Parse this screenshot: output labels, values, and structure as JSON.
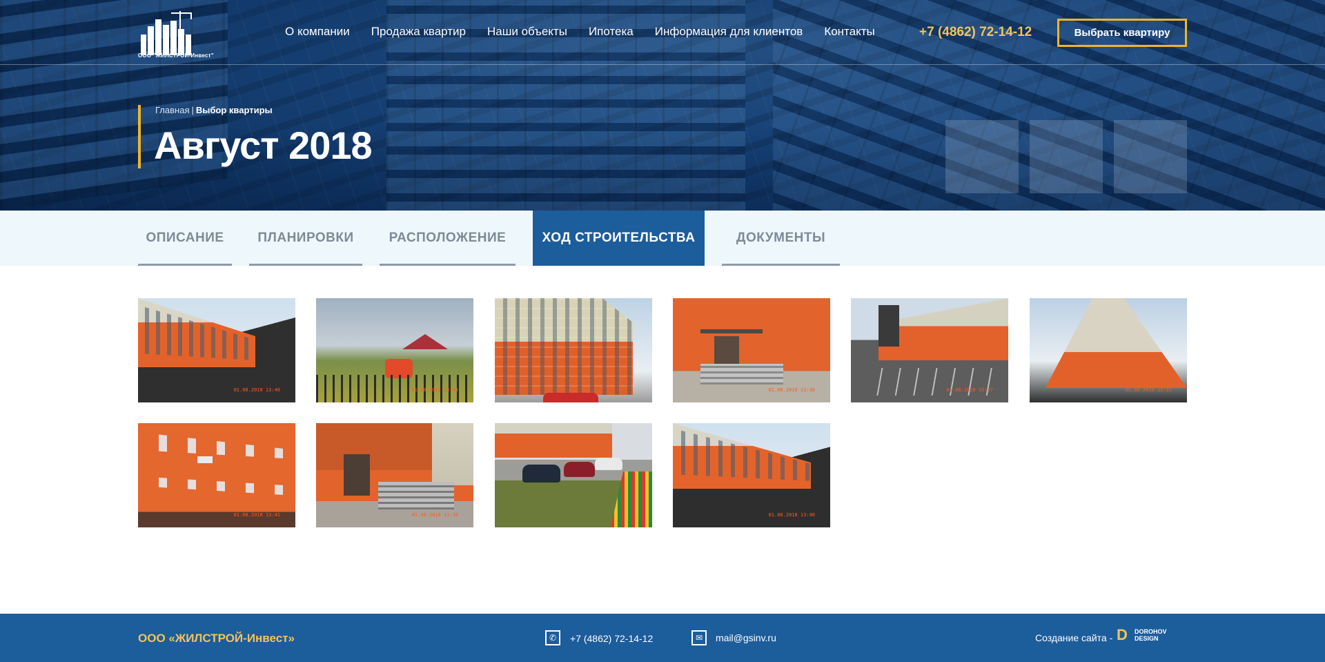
{
  "header": {
    "logo_text": "ООО \"ЖИЛСТРОЙ-Инвест\"",
    "nav": [
      "О компании",
      "Продажа квартир",
      "Наши объекты",
      "Ипотека",
      "Информация для клиентов",
      "Контакты"
    ],
    "phone": "+7 (4862) 72-14-12",
    "cta_label": "Выбрать квартиру"
  },
  "hero": {
    "breadcrumb_home": "Главная",
    "breadcrumb_sep": "|",
    "breadcrumb_current": "Выбор квартиры",
    "title": "Август 2018"
  },
  "tabs": [
    {
      "label": "ОПИСАНИЕ",
      "active": false
    },
    {
      "label": "ПЛАНИРОВКИ",
      "active": false
    },
    {
      "label": "РАСПОЛОЖЕНИЕ",
      "active": false
    },
    {
      "label": "ХОД СТРОИТЕЛЬСТВА",
      "active": true
    },
    {
      "label": "ДОКУМЕНТЫ",
      "active": false
    }
  ],
  "gallery": {
    "photos": [
      {
        "kind": "facade-road",
        "timestamp": "01.08.2018 13:40"
      },
      {
        "kind": "playground",
        "timestamp": "01.08.2018 13:44"
      },
      {
        "kind": "tower",
        "timestamp": ""
      },
      {
        "kind": "entrance",
        "timestamp": "01.08.2018 13:38"
      },
      {
        "kind": "lot",
        "timestamp": "01.08.2018 13:47"
      },
      {
        "kind": "low",
        "timestamp": "01.08.2018 13:51"
      },
      {
        "kind": "wall",
        "timestamp": "01.08.2018 13:41"
      },
      {
        "kind": "entrance2",
        "timestamp": "01.08.2018 13:39"
      },
      {
        "kind": "cars",
        "timestamp": ""
      },
      {
        "kind": "road2",
        "timestamp": "01.08.2018 13:40"
      }
    ]
  },
  "footer": {
    "company": "ООО «ЖИЛСТРОЙ-Инвест»",
    "phone": "+7 (4862) 72-14-12",
    "email": "mail@gsinv.ru",
    "credit": "Создание сайта -",
    "brand_line1": "DOROHOV",
    "brand_line2": "DESIGN"
  },
  "colors": {
    "accent": "#f0b52a",
    "primary": "#1c5d9c",
    "tabs_bg": "#eef7fb"
  },
  "icons": {
    "phone": "phone-icon",
    "mail": "mail-icon"
  }
}
